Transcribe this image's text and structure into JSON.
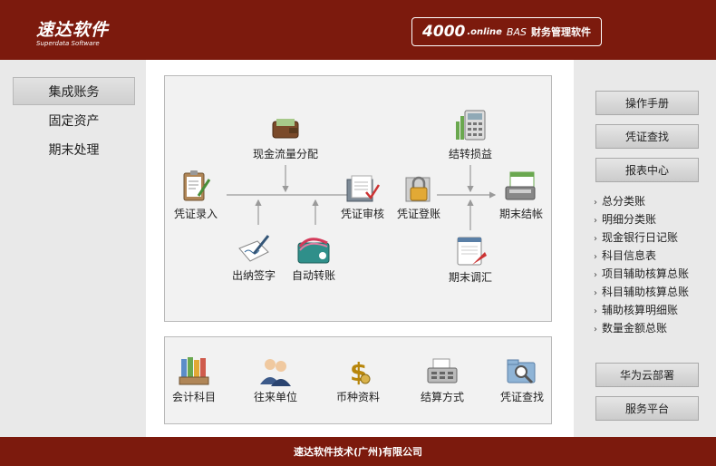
{
  "header": {
    "logo_text": "速达软件",
    "logo_subtext": "Superdata Software",
    "product_version": "4000",
    "product_edition": ".online",
    "product_bas": "BAS",
    "product_title": "财务管理软件"
  },
  "left_nav": {
    "items": [
      {
        "label": "集成账务",
        "active": true
      },
      {
        "label": "固定资产"
      },
      {
        "label": "期末处理"
      }
    ]
  },
  "flow": {
    "nodes": {
      "voucher_entry": "凭证录入",
      "cash_flow": "现金流量分配",
      "voucher_audit": "凭证审核",
      "voucher_post": "凭证登账",
      "transfer_pl": "结转损益",
      "period_close": "期末结帐",
      "cashier_sign": "出纳签字",
      "auto_transfer": "自动转账",
      "period_adjust": "期末调汇"
    }
  },
  "basics": {
    "items": {
      "accounts": "会计科目",
      "partners": "往来单位",
      "currency": "币种资料",
      "settlement": "结算方式",
      "voucher_query": "凭证查找"
    }
  },
  "right_panel": {
    "manual": "操作手册",
    "voucher_query": "凭证查找",
    "report_center": "报表中心",
    "reports": [
      "总分类账",
      "明细分类账",
      "现金银行日记账",
      "科目信息表",
      "项目辅助核算总账",
      "科目辅助核算总账",
      "辅助核算明细账",
      "数量金额总账"
    ],
    "huawei_cloud": "华为云部署",
    "service_platform": "服务平台"
  },
  "footer": {
    "company": "速达软件技术(广州)有限公司"
  },
  "colors": {
    "brand": "#7c1a0d",
    "panel_bg": "#e9e9e9",
    "box_bg": "#f2f2f2"
  }
}
